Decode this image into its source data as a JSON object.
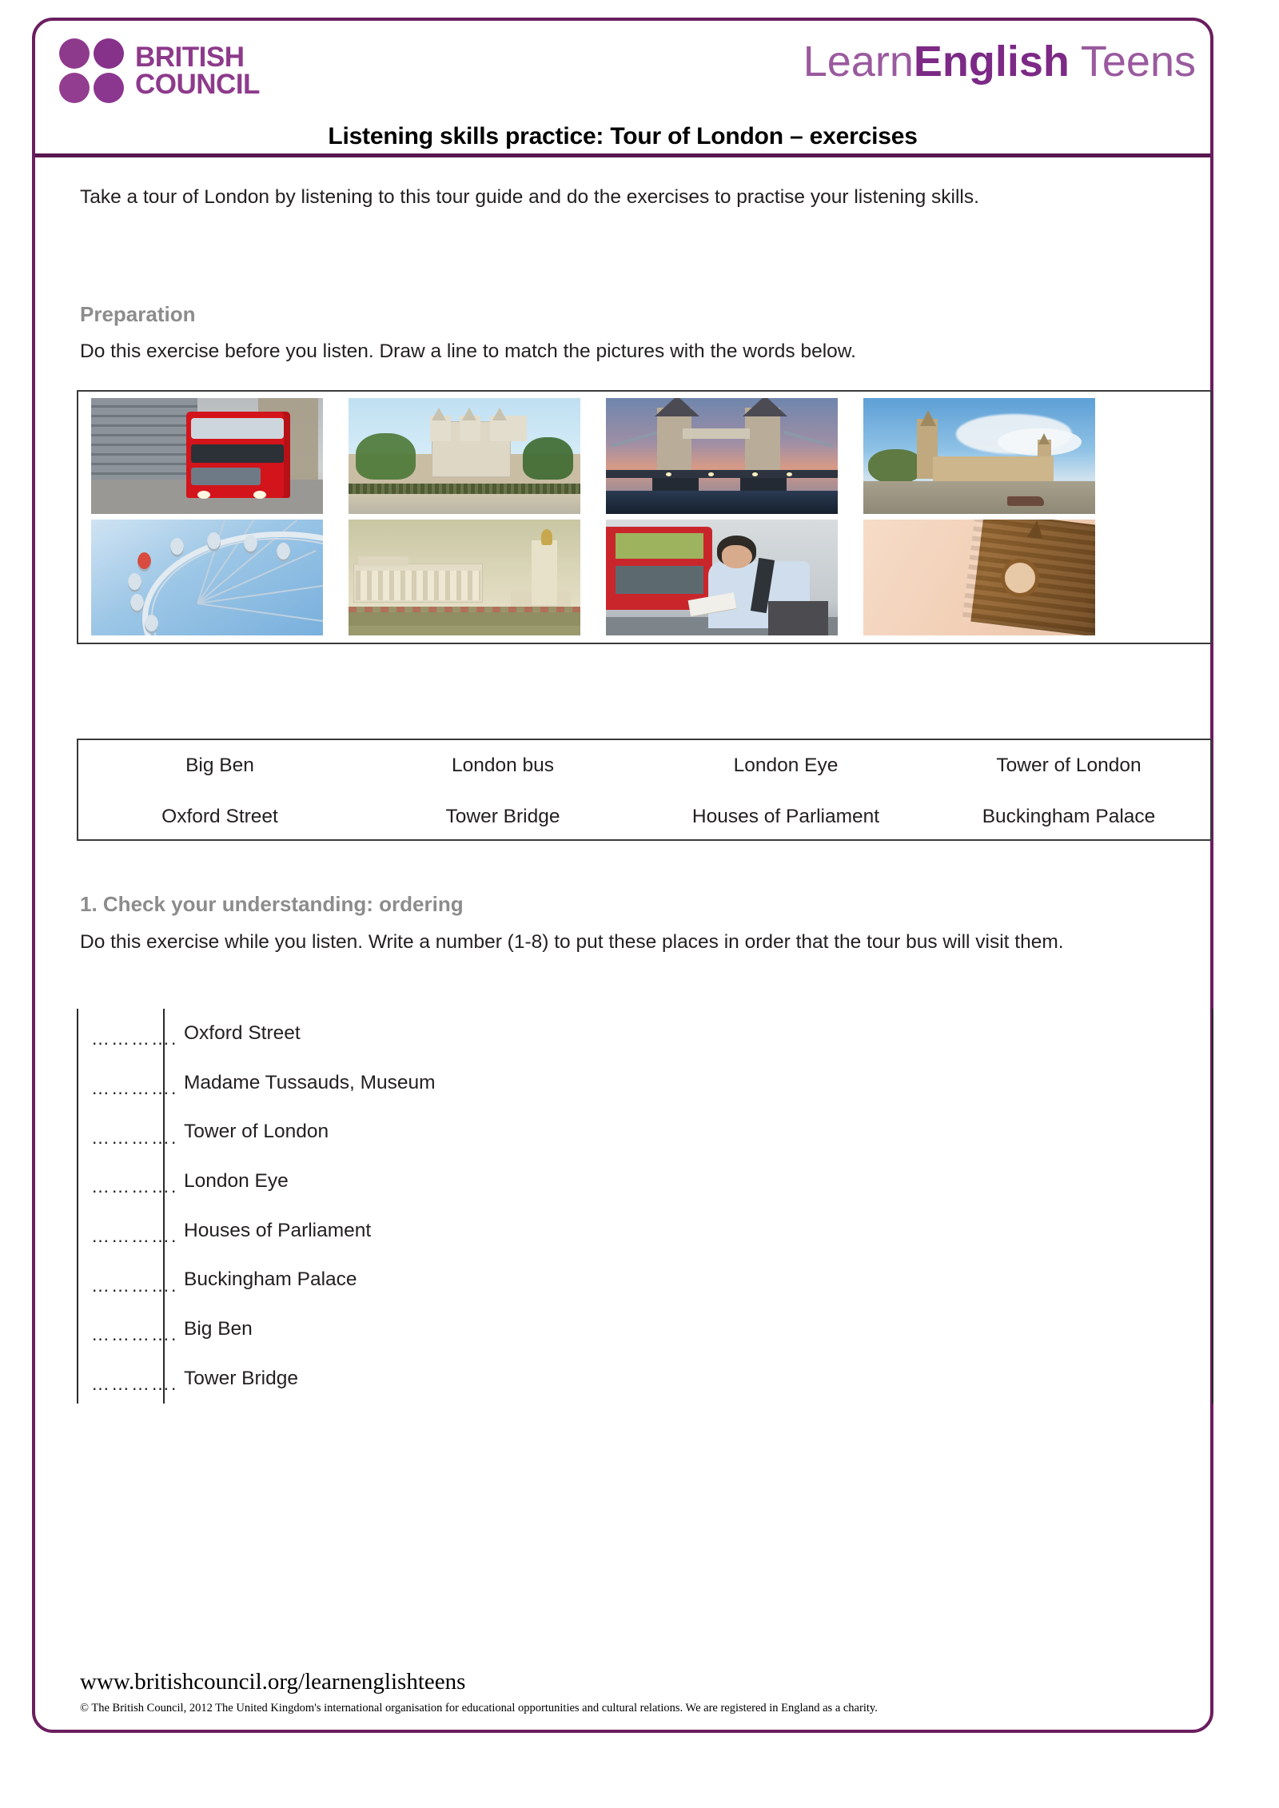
{
  "document": {
    "title": "Listening skills practice: Tour of London – exercises",
    "intro": "Take a tour of London by listening to this tour guide and do the exercises to practise your listening skills."
  },
  "brand": {
    "british_council": {
      "line1": "BRITISH",
      "line2": "COUNCIL",
      "color": "#8e3a8c"
    },
    "learnenglish_teens": {
      "part1": "Learn",
      "part2": "English",
      "part3": " Teens",
      "color": "#8b3a8e"
    },
    "frame_color": "#6b1e5f"
  },
  "preparation": {
    "heading": "Preparation",
    "instructions": "Do this exercise before you listen. Draw a line to match the pictures with the words below.",
    "pictures": [
      {
        "alt": "London bus",
        "name": "picture-london-bus"
      },
      {
        "alt": "Tower of London",
        "name": "picture-tower-of-london"
      },
      {
        "alt": "Tower Bridge",
        "name": "picture-tower-bridge"
      },
      {
        "alt": "Houses of Parliament",
        "name": "picture-houses-of-parliament"
      },
      {
        "alt": "London Eye",
        "name": "picture-london-eye"
      },
      {
        "alt": "Buckingham Palace",
        "name": "picture-buckingham-palace"
      },
      {
        "alt": "Oxford Street",
        "name": "picture-oxford-street"
      },
      {
        "alt": "Big Ben",
        "name": "picture-big-ben"
      }
    ],
    "word_bank": [
      [
        "Big Ben",
        "London bus",
        "London Eye",
        "Tower of London"
      ],
      [
        "Oxford Street",
        "Tower Bridge",
        "Houses of Parliament",
        "Buckingham Palace"
      ]
    ]
  },
  "exercise1": {
    "heading": "1. Check your understanding: ordering",
    "instructions": "Do this exercise while you listen. Write a number (1-8) to put these places in order that the tour bus will visit them.",
    "blank": "………….",
    "items": [
      "Oxford Street",
      "Madame Tussauds, Museum",
      "Tower of London",
      "London Eye",
      "Houses of Parliament",
      "Buckingham Palace",
      "Big Ben",
      "Tower Bridge"
    ]
  },
  "footer": {
    "url": "www.britishcouncil.org/learnenglishteens",
    "copyright": "© The British Council, 2012 The United Kingdom's international organisation for educational opportunities and cultural relations. We are registered in England as a charity."
  }
}
